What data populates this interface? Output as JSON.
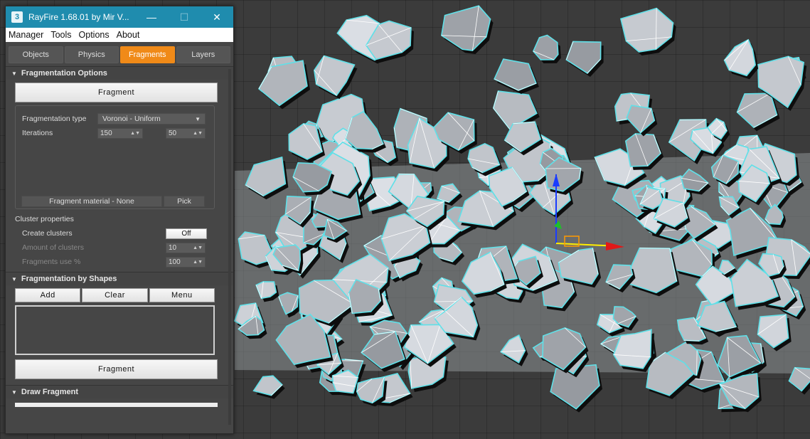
{
  "window": {
    "title": "RayFire 1.68.01     by Mir V...",
    "icon": "rayfire-app-icon",
    "minimize": "—",
    "maximize": "☐",
    "close": "✕"
  },
  "menu": [
    "Manager",
    "Tools",
    "Options",
    "About"
  ],
  "tabs": [
    {
      "label": "Objects",
      "active": false
    },
    {
      "label": "Physics",
      "active": false
    },
    {
      "label": "Fragments",
      "active": true
    },
    {
      "label": "Layers",
      "active": false
    }
  ],
  "fragmentation_options": {
    "header": "Fragmentation Options",
    "fragment_button": "Fragment",
    "type_label": "Fragmentation type",
    "type_value": "Voronoi - Uniform",
    "iterations_label": "Iterations",
    "iterations_min": "150",
    "iterations_max": "50",
    "material_button": "Fragment material - None",
    "pick_button": "Pick"
  },
  "cluster_properties": {
    "title": "Cluster properties",
    "create_label": "Create clusters",
    "create_value": "Off",
    "amount_label": "Amount of clusters",
    "amount_value": "10",
    "use_label": "Fragments use %",
    "use_value": "100"
  },
  "fragmentation_by_shapes": {
    "header": "Fragmentation by Shapes",
    "add": "Add",
    "clear": "Clear",
    "menu": "Menu",
    "fragment_button": "Fragment"
  },
  "draw_fragment": {
    "header": "Draw Fragment"
  },
  "colors": {
    "titlebar": "#1f8cae",
    "active_tab": "#f08a18",
    "selection_outline": "#5fe0e8"
  }
}
